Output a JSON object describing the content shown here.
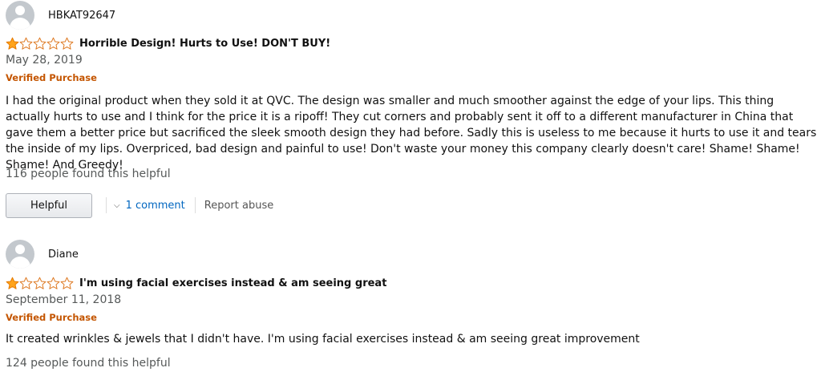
{
  "colors": {
    "star": "#ffa41c",
    "verified": "#c45500",
    "link": "#0066c0",
    "muted": "#565959"
  },
  "reviews": [
    {
      "author": "HBKAT92647",
      "rating": 1,
      "rating_max": 5,
      "title": "Horrible Design! Hurts to Use! DON'T BUY!",
      "date": "May 28, 2019",
      "verified": "Verified Purchase",
      "body": "I had the original product when they sold it at QVC. The design was smaller and much smoother against the edge of your lips. This thing actually hurts to use and I think for the price it is a ripoff! They cut corners and probably sent it off to a different manufacturer in China that gave them a better price but sacrificed the sleek smooth design they had before. Sadly this is useless to me because it hurts to use it and tears the inside of my lips. Overpriced, bad design and painful to use! Don't waste your money this company clearly doesn't care! Shame! Shame! Shame! And Greedy!",
      "helpful_count": "116 people found this helpful",
      "helpful_button": "Helpful",
      "comment_link": "1 comment",
      "report_link": "Report abuse"
    },
    {
      "author": "Diane",
      "rating": 1,
      "rating_max": 5,
      "title": "I'm using facial exercises instead & am seeing great",
      "date": "September 11, 2018",
      "verified": "Verified Purchase",
      "body": "It created wrinkles & jewels that I didn't have. I'm using facial exercises instead & am seeing great improvement",
      "helpful_count": "124 people found this helpful"
    }
  ]
}
